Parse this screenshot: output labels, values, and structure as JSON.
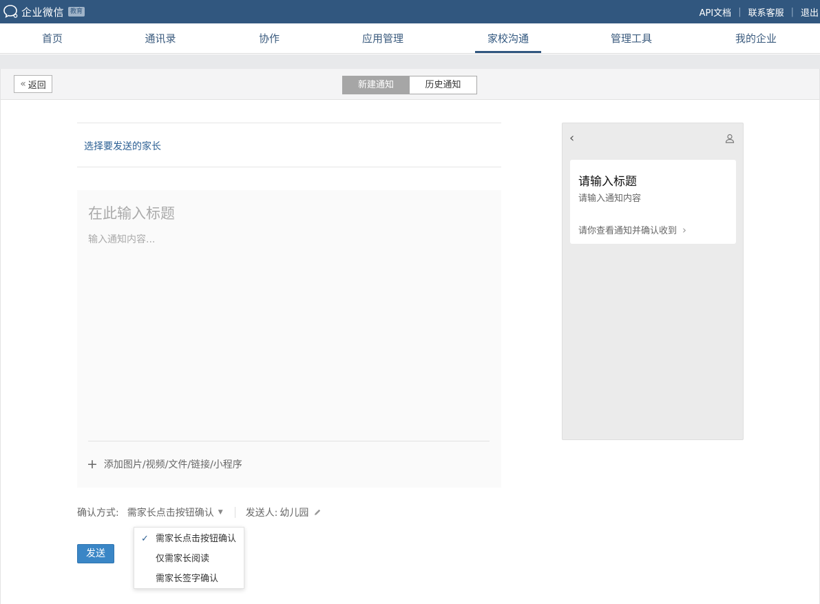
{
  "topbar": {
    "logo_text": "企业微信",
    "logo_badge": "教育",
    "links": [
      "API文档",
      "联系客服",
      "退出"
    ]
  },
  "nav": {
    "items": [
      "首页",
      "通讯录",
      "协作",
      "应用管理",
      "家校沟通",
      "管理工具",
      "我的企业"
    ],
    "active": "家校沟通"
  },
  "subheader": {
    "back_label": "返回",
    "tabs": [
      "新建通知",
      "历史通知"
    ]
  },
  "form": {
    "recipient_label": "选择要发送的家长",
    "title_placeholder": "在此输入标题",
    "body_placeholder": "输入通知内容...",
    "attach_label": "添加图片/视频/文件/链接/小程序",
    "confirm_label": "确认方式:",
    "confirm_value": "需家长点击按钮确认",
    "sender_label": "发送人:",
    "sender_value": "幼儿园",
    "send_label": "发送"
  },
  "dropdown": {
    "options": [
      "需家长点击按钮确认",
      "仅需家长阅读",
      "需家长签字确认"
    ],
    "selected": "需家长点击按钮确认"
  },
  "preview": {
    "title": "请输入标题",
    "subtitle": "请输入通知内容",
    "footer": "请你查看通知并确认收到"
  },
  "colors": {
    "brand": "#31577f",
    "send_button": "#3a86c6",
    "link": "#2b5f93"
  }
}
